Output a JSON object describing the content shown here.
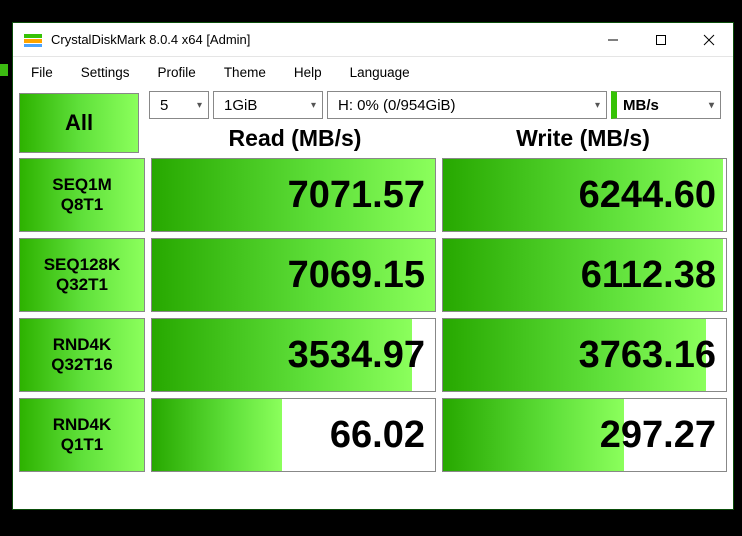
{
  "window": {
    "title": "CrystalDiskMark 8.0.4 x64 [Admin]"
  },
  "menu": {
    "file": "File",
    "settings": "Settings",
    "profile": "Profile",
    "theme": "Theme",
    "help": "Help",
    "language": "Language"
  },
  "toolbar": {
    "all_label": "All",
    "count": "5",
    "test_size": "1GiB",
    "drive": "H: 0% (0/954GiB)",
    "unit": "MB/s"
  },
  "headers": {
    "read": "Read (MB/s)",
    "write": "Write (MB/s)"
  },
  "rows": [
    {
      "label_line1": "SEQ1M",
      "label_line2": "Q8T1",
      "read": "7071.57",
      "write": "6244.60",
      "read_fill": 100,
      "write_fill": 99
    },
    {
      "label_line1": "SEQ128K",
      "label_line2": "Q32T1",
      "read": "7069.15",
      "write": "6112.38",
      "read_fill": 100,
      "write_fill": 99
    },
    {
      "label_line1": "RND4K",
      "label_line2": "Q32T16",
      "read": "3534.97",
      "write": "3763.16",
      "read_fill": 92,
      "write_fill": 93
    },
    {
      "label_line1": "RND4K",
      "label_line2": "Q1T1",
      "read": "66.02",
      "write": "297.27",
      "read_fill": 46,
      "write_fill": 64
    }
  ]
}
